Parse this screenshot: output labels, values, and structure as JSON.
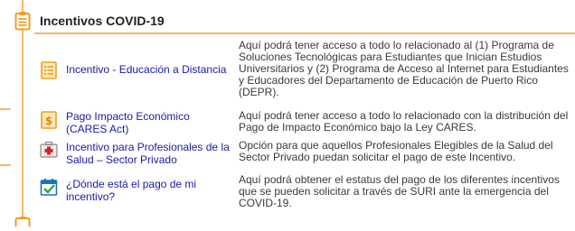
{
  "section": {
    "title": "Incentivos COVID-19",
    "icon": "clipboard-icon",
    "accent_color": "#f2b866"
  },
  "items": [
    {
      "icon": "document-list-icon",
      "link": "Incentivo - Educación a Distancia",
      "description": "Aquí podrá tener acceso a todo lo relacionado al (1) Programa de Soluciones Tecnológicas para Estudiantes que Inician Estudios Universitarios y (2) Programa de Acceso al Internet para Estudiantes y Educadores del Departamento de Educación de Puerto Rico (DEPR)."
    },
    {
      "icon": "dollar-document-icon",
      "link": "Pago Impacto Económico (CARES Act)",
      "description": "Aquí podrá tener acceso a todo lo relacionado con la distribución del Pago de Impacto Económico bajo la Ley CARES."
    },
    {
      "icon": "medical-kit-icon",
      "link": "Incentivo para Profesionales de la Salud – Sector Privado",
      "description": "Opción para que aquellos Profesionales Elegibles de la Salud del Sector Privado puedan solicitar el pago de este Incentivo."
    },
    {
      "icon": "calendar-check-icon",
      "link": "¿Dónde está el pago de mi incentivo?",
      "description": "Aquí podrá obtener el estatus del pago de los diferentes incentivos que se pueden solicitar a través de SURI ante la emergencia del COVID-19."
    }
  ],
  "link_color": "#1a1aa6"
}
